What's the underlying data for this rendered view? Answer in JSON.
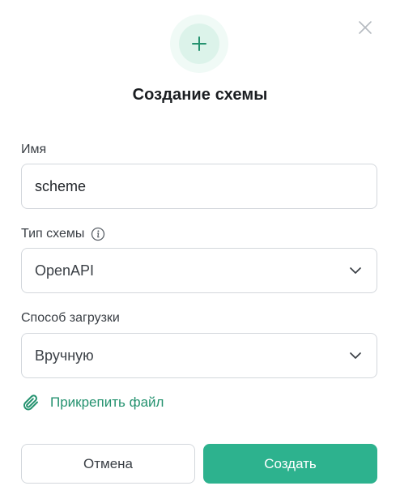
{
  "dialog": {
    "title": "Создание схемы",
    "header_icon": "plus-icon",
    "close_icon": "close-icon"
  },
  "fields": {
    "name": {
      "label": "Имя",
      "value": "scheme",
      "placeholder": ""
    },
    "scheme_type": {
      "label": "Тип схемы",
      "info_icon": "info-icon",
      "value": "OpenAPI"
    },
    "upload_method": {
      "label": "Способ загрузки",
      "value": "Вручную"
    }
  },
  "attach": {
    "label": "Прикрепить файл",
    "icon": "paperclip-icon"
  },
  "buttons": {
    "cancel": "Отмена",
    "create": "Создать"
  },
  "colors": {
    "accent": "#2db28e",
    "accent_text": "#24926f",
    "border": "#d3d7dc",
    "icon_bg_outer": "#f0faf6",
    "icon_bg_inner": "#dcf3ea"
  }
}
